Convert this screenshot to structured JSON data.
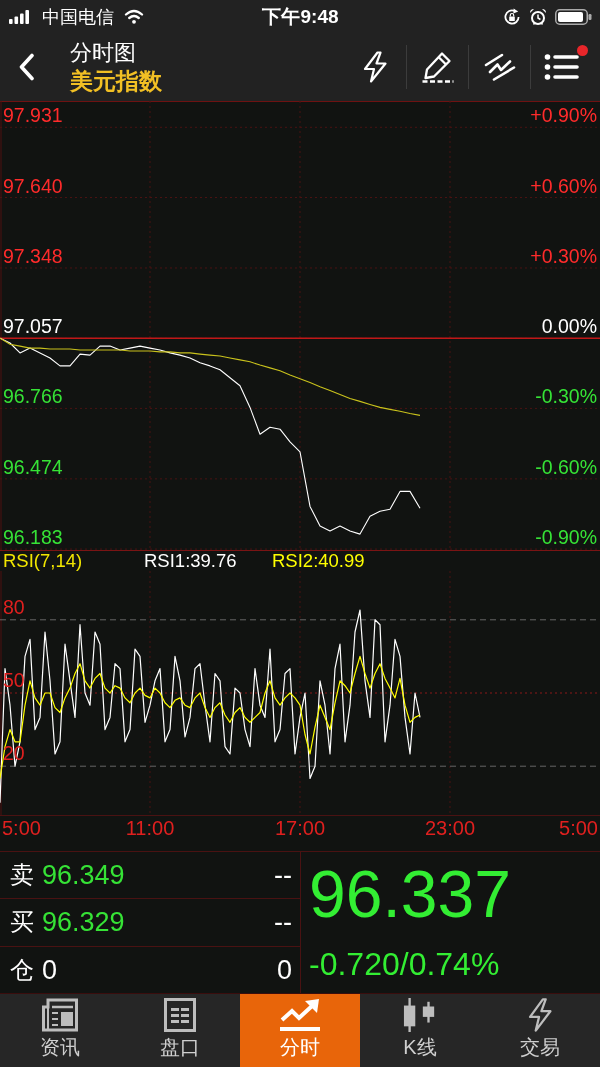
{
  "status_bar": {
    "carrier": "中国电信",
    "time": "下午9:48"
  },
  "header": {
    "title": "分时图",
    "subtitle": "美元指数",
    "menu_dot": true
  },
  "price_chart": {
    "chart_data": {
      "type": "line",
      "x": [
        5,
        5.4,
        5.8,
        6.2,
        6.6,
        7,
        7.4,
        7.8,
        8.2,
        8.6,
        9,
        9.4,
        9.8,
        10.2,
        10.6,
        11,
        11.4,
        11.8,
        12.2,
        12.6,
        13,
        13.4,
        13.8,
        14.2,
        14.6,
        15,
        15.4,
        15.8,
        16.2,
        16.6,
        17,
        17.4,
        17.8,
        18.2,
        18.6,
        19,
        19.4,
        19.8,
        20.2,
        20.6,
        21,
        21.4,
        21.8
      ],
      "series": [
        {
          "color": "#ffffff",
          "values": [
            97.057,
            97.037,
            96.996,
            97.016,
            96.996,
            96.975,
            96.942,
            96.942,
            96.991,
            96.987,
            97.024,
            97.024,
            97.008,
            97.016,
            97.024,
            97.016,
            97.008,
            96.996,
            96.987,
            96.975,
            96.955,
            96.942,
            96.926,
            96.893,
            96.86,
            96.77,
            96.659,
            96.688,
            96.68,
            96.627,
            96.586,
            96.36,
            96.278,
            96.258,
            96.278,
            96.258,
            96.245,
            96.319,
            96.34,
            96.348,
            96.422,
            96.422,
            96.352
          ]
        },
        {
          "color": "#c9c21c",
          "values": [
            97.057,
            97.032,
            97.024,
            97.016,
            97.016,
            97.012,
            97.012,
            97.012,
            97.008,
            97.008,
            97.008,
            97.008,
            97.008,
            97.004,
            97.004,
            97.004,
            97,
            97,
            96.996,
            96.996,
            96.991,
            96.987,
            96.983,
            96.975,
            96.967,
            96.959,
            96.946,
            96.934,
            96.922,
            96.905,
            96.889,
            96.873,
            96.856,
            96.84,
            96.823,
            96.807,
            96.795,
            96.782,
            96.77,
            96.762,
            96.754,
            96.745,
            96.737
          ]
        }
      ],
      "xlim": [
        5,
        29
      ],
      "ylim": [
        96.175,
        98.04
      ],
      "yticks": [
        {
          "value": 97.931,
          "label": "97.931"
        },
        {
          "value": 97.64,
          "label": "97.640"
        },
        {
          "value": 97.348,
          "label": "97.348"
        },
        {
          "value": 97.057,
          "label": "97.057"
        },
        {
          "value": 96.766,
          "label": "96.766"
        },
        {
          "value": 96.474,
          "label": "96.474"
        },
        {
          "value": 96.183,
          "label": "96.183"
        }
      ],
      "grid": true,
      "ref_lines": [
        {
          "axis": "y",
          "value": 97.057
        }
      ]
    },
    "percent_labels": [
      "+0.90%",
      "+0.60%",
      "+0.30%",
      "0.00%",
      "-0.30%",
      "-0.60%",
      "-0.90%"
    ]
  },
  "rsi_chart": {
    "chart_data": {
      "type": "line",
      "title": "RSI(7,14)",
      "x": [
        5,
        5.2,
        5.4,
        5.6,
        5.8,
        6,
        6.2,
        6.4,
        6.6,
        6.8,
        7,
        7.2,
        7.4,
        7.6,
        7.8,
        8,
        8.2,
        8.4,
        8.6,
        8.8,
        9,
        9.2,
        9.4,
        9.6,
        9.8,
        10,
        10.2,
        10.4,
        10.6,
        10.8,
        11,
        11.2,
        11.4,
        11.6,
        11.8,
        12,
        12.2,
        12.4,
        12.6,
        12.8,
        13,
        13.2,
        13.4,
        13.6,
        13.8,
        14,
        14.2,
        14.4,
        14.6,
        14.8,
        15,
        15.2,
        15.4,
        15.6,
        15.8,
        16,
        16.2,
        16.4,
        16.6,
        16.8,
        17,
        17.2,
        17.4,
        17.6,
        17.8,
        18,
        18.2,
        18.4,
        18.6,
        18.8,
        19,
        19.2,
        19.4,
        19.6,
        19.8,
        20,
        20.2,
        20.4,
        20.6,
        20.8,
        21,
        21.2,
        21.4,
        21.6,
        21.8
      ],
      "series": [
        {
          "color": "#ffffff",
          "values": [
            5,
            60,
            45,
            20,
            30,
            65,
            72,
            35,
            40,
            75,
            55,
            25,
            30,
            70,
            55,
            40,
            78,
            50,
            45,
            75,
            70,
            35,
            40,
            62,
            60,
            30,
            35,
            68,
            65,
            38,
            45,
            55,
            60,
            30,
            35,
            65,
            55,
            32,
            40,
            60,
            62,
            45,
            30,
            58,
            55,
            28,
            25,
            52,
            50,
            35,
            28,
            60,
            45,
            40,
            68,
            30,
            35,
            58,
            60,
            25,
            40,
            50,
            15,
            20,
            55,
            45,
            25,
            60,
            70,
            30,
            45,
            75,
            84,
            55,
            40,
            80,
            78,
            30,
            45,
            72,
            65,
            40,
            25,
            50,
            40
          ]
        },
        {
          "color": "#ffff00",
          "values": [
            15,
            28,
            35,
            30,
            30,
            45,
            55,
            48,
            45,
            50,
            50,
            44,
            42,
            48,
            52,
            58,
            62,
            55,
            52,
            56,
            58,
            52,
            50,
            53,
            52,
            48,
            46,
            50,
            52,
            49,
            48,
            52,
            50,
            46,
            44,
            47,
            48,
            45,
            44,
            48,
            50,
            44,
            40,
            44,
            46,
            41,
            38,
            42,
            44,
            40,
            38,
            40,
            42,
            50,
            55,
            48,
            45,
            48,
            50,
            48,
            45,
            33,
            25,
            36,
            45,
            40,
            35,
            46,
            55,
            53,
            50,
            58,
            65,
            58,
            52,
            58,
            62,
            56,
            52,
            48,
            56,
            45,
            38,
            40,
            41
          ]
        }
      ],
      "xlim": [
        5,
        29
      ],
      "ylim": [
        0,
        100
      ],
      "yticks": [
        20,
        50,
        80
      ],
      "xticks": [
        {
          "value": 5,
          "label": "5:00"
        },
        {
          "value": 11,
          "label": "11:00"
        },
        {
          "value": 17,
          "label": "17:00"
        },
        {
          "value": 23,
          "label": "23:00"
        }
      ],
      "grid": true,
      "ref_lines": [
        {
          "axis": "y",
          "value": 50
        }
      ]
    },
    "legend": [
      "RSI1:39.76",
      "RSI2:40.99"
    ],
    "session_end_label": "5:00"
  },
  "quote": {
    "rows": [
      {
        "kind": "price",
        "label": "卖",
        "value": "96.349",
        "volume": "--"
      },
      {
        "kind": "price",
        "label": "买",
        "value": "96.329",
        "volume": "--"
      },
      {
        "kind": "position",
        "label": "仓",
        "value": "0",
        "volume": "0"
      }
    ],
    "last": "96.337",
    "change": "-0.720/0.74%"
  },
  "tabs": [
    {
      "kind": "news",
      "label": "资讯",
      "selected": false
    },
    {
      "kind": "quote",
      "label": "盘口",
      "selected": false
    },
    {
      "kind": "timeshare",
      "label": "分时",
      "selected": true
    },
    {
      "kind": "kline",
      "label": "K线",
      "selected": false
    },
    {
      "kind": "trade",
      "label": "交易",
      "selected": false
    }
  ]
}
